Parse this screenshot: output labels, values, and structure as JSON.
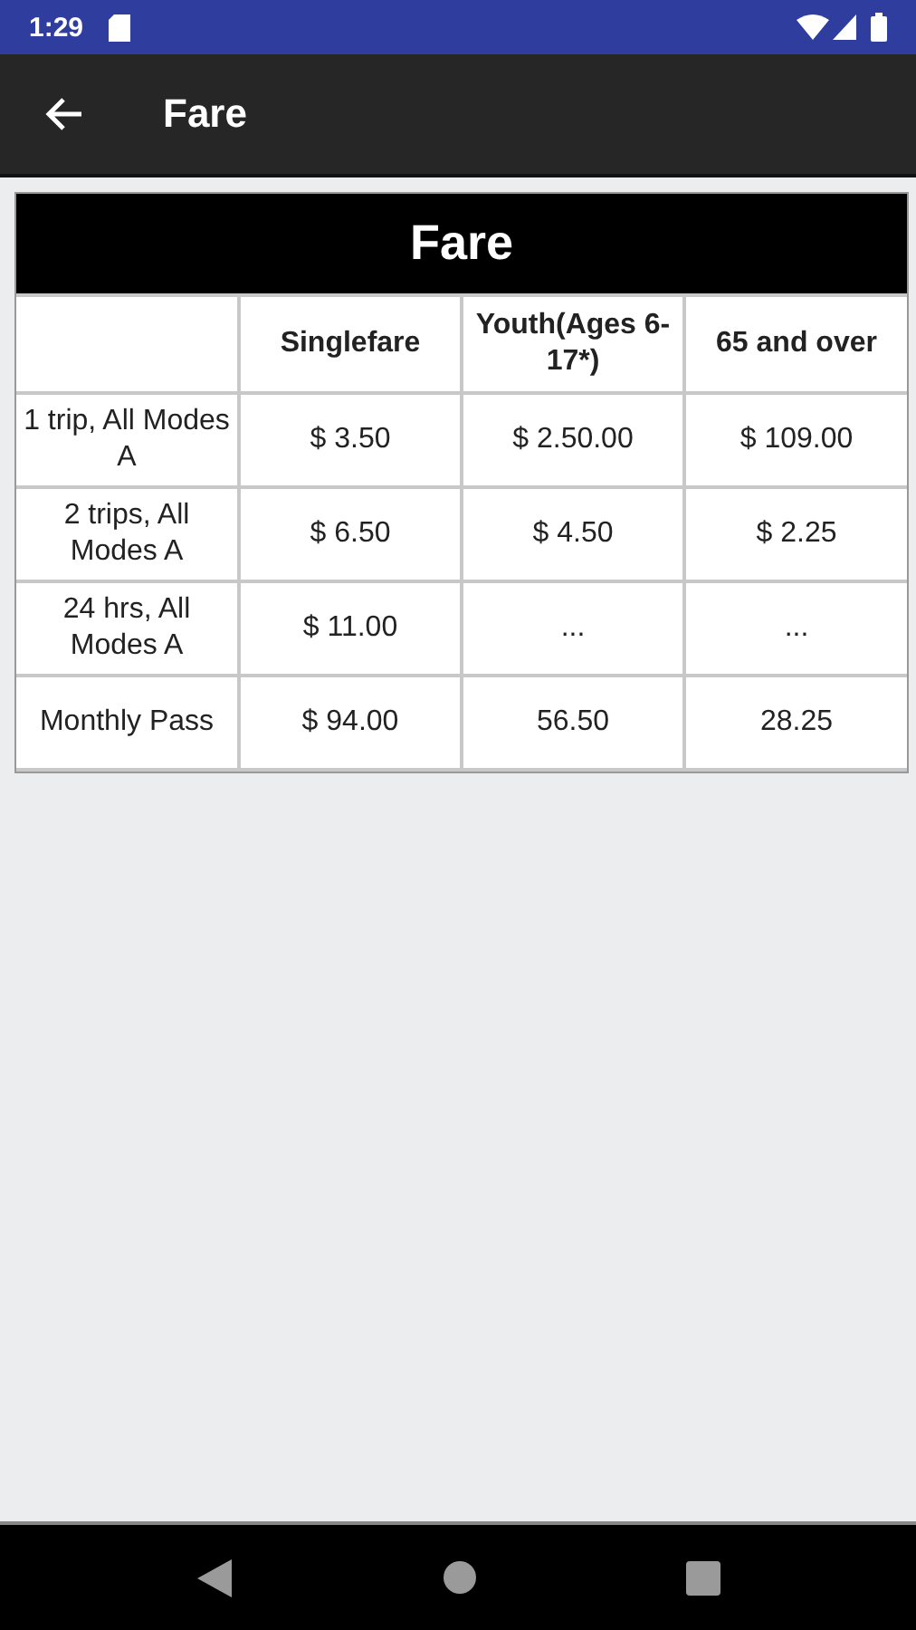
{
  "status_bar": {
    "time": "1:29"
  },
  "app_bar": {
    "title": "Fare"
  },
  "table": {
    "title": "Fare",
    "columns": [
      "",
      "Singlefare",
      "Youth(Ages 6-17*)",
      "65 and over"
    ],
    "rows": [
      [
        "1 trip, All Modes A",
        "$ 3.50",
        "$ 2.50.00",
        "$ 109.00"
      ],
      [
        "2 trips, All Modes A",
        "$ 6.50",
        "$ 4.50",
        "$ 2.25"
      ],
      [
        "24 hrs, All Modes A",
        "$ 11.00",
        "...",
        "..."
      ],
      [
        "Monthly Pass",
        "$ 94.00",
        "56.50",
        "28.25"
      ]
    ]
  }
}
